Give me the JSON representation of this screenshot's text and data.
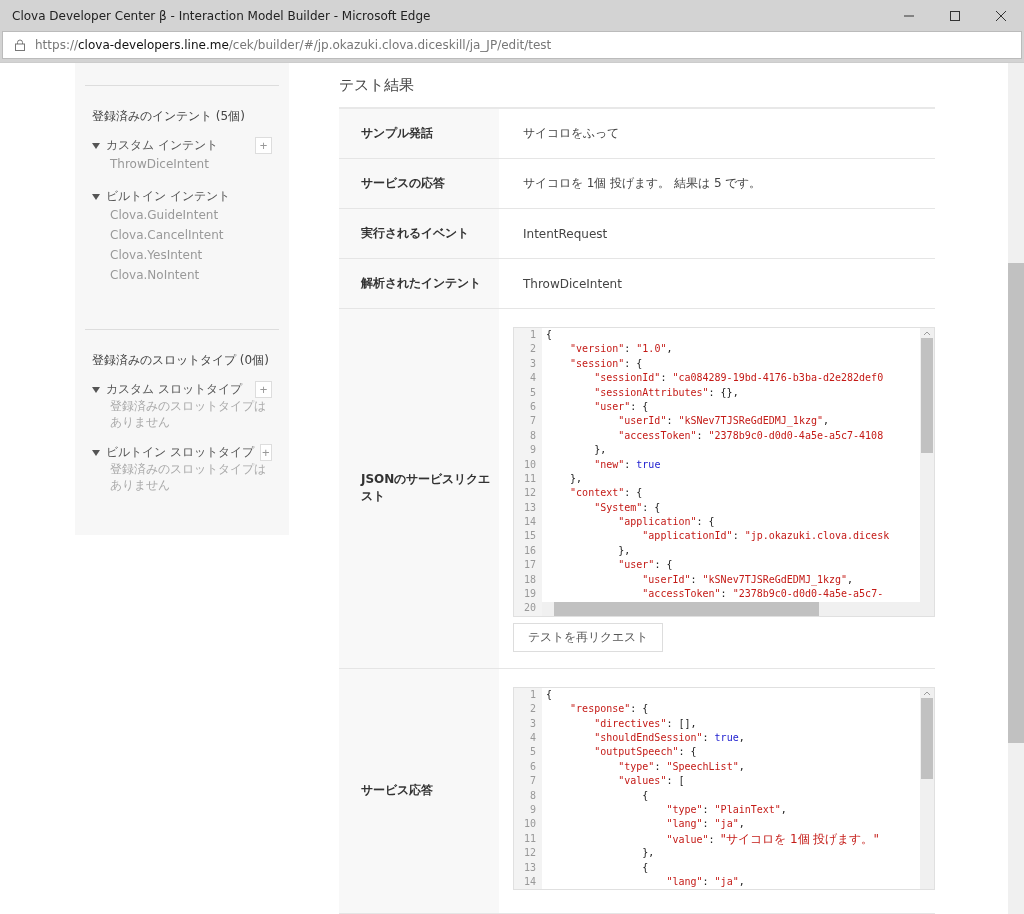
{
  "window": {
    "title": "Clova Developer Center β - Interaction Model Builder - Microsoft Edge"
  },
  "address_bar": {
    "scheme": "https://",
    "host": "clova-developers.line.me",
    "path": "/cek/builder/#/jp.okazuki.clova.diceskill/ja_JP/edit/test"
  },
  "sidebar": {
    "sections": [
      {
        "heading": "登録済みのインテント (5個)",
        "groups": [
          {
            "label": "カスタム インテント",
            "expanded": true,
            "add": "+",
            "items": [
              "ThrowDiceIntent"
            ]
          },
          {
            "label": "ビルトイン インテント",
            "expanded": true,
            "items": [
              "Clova.GuideIntent",
              "Clova.CancelIntent",
              "Clova.YesIntent",
              "Clova.NoIntent"
            ]
          }
        ]
      },
      {
        "heading": "登録済みのスロットタイプ (0個)",
        "groups": [
          {
            "label": "カスタム スロットタイプ",
            "expanded": true,
            "add": "+",
            "empty": "登録済みのスロットタイプはありません"
          },
          {
            "label": "ビルトイン スロットタイプ",
            "expanded": true,
            "add": "+",
            "empty": "登録済みのスロットタイプはありません"
          }
        ]
      }
    ]
  },
  "test_result": {
    "title": "テスト結果",
    "rows": [
      {
        "kind": "text",
        "label": "サンプル発話",
        "value": "サイコロをふって"
      },
      {
        "kind": "text",
        "label": "サービスの応答",
        "value": "サイコロを 1個 投げます。 結果は 5 です。"
      },
      {
        "kind": "text",
        "label": "実行されるイベント",
        "value": "IntentRequest"
      },
      {
        "kind": "text",
        "label": "解析されたインテント",
        "value": "ThrowDiceIntent"
      },
      {
        "kind": "code",
        "label": "JSONのサービスリクエスト",
        "button": "テストを再リクエスト",
        "lines": [
          {
            "number": "1",
            "tokens": [
              {
                "kind": "punct",
                "text": "{"
              }
            ]
          },
          {
            "number": "2",
            "tokens": [
              {
                "kind": "string",
                "text": "    \"version\""
              },
              {
                "kind": "punct",
                "text": ": "
              },
              {
                "kind": "string",
                "text": "\"1.0\""
              },
              {
                "kind": "punct",
                "text": ","
              }
            ]
          },
          {
            "number": "3",
            "tokens": [
              {
                "kind": "string",
                "text": "    \"session\""
              },
              {
                "kind": "punct",
                "text": ": {"
              }
            ]
          },
          {
            "number": "4",
            "tokens": [
              {
                "kind": "string",
                "text": "        \"sessionId\""
              },
              {
                "kind": "punct",
                "text": ": "
              },
              {
                "kind": "string",
                "text": "\"ca084289-19bd-4176-b3ba-d2e282def0"
              }
            ]
          },
          {
            "number": "5",
            "tokens": [
              {
                "kind": "string",
                "text": "        \"sessionAttributes\""
              },
              {
                "kind": "punct",
                "text": ": {},"
              }
            ]
          },
          {
            "number": "6",
            "tokens": [
              {
                "kind": "string",
                "text": "        \"user\""
              },
              {
                "kind": "punct",
                "text": ": {"
              }
            ]
          },
          {
            "number": "7",
            "tokens": [
              {
                "kind": "string",
                "text": "            \"userId\""
              },
              {
                "kind": "punct",
                "text": ": "
              },
              {
                "kind": "string",
                "text": "\"kSNev7TJSReGdEDMJ_1kzg\""
              },
              {
                "kind": "punct",
                "text": ","
              }
            ]
          },
          {
            "number": "8",
            "tokens": [
              {
                "kind": "string",
                "text": "            \"accessToken\""
              },
              {
                "kind": "punct",
                "text": ": "
              },
              {
                "kind": "string",
                "text": "\"2378b9c0-d0d0-4a5e-a5c7-4108"
              }
            ]
          },
          {
            "number": "9",
            "tokens": [
              {
                "kind": "punct",
                "text": "        },"
              }
            ]
          },
          {
            "number": "10",
            "tokens": [
              {
                "kind": "string",
                "text": "        \"new\""
              },
              {
                "kind": "punct",
                "text": ": "
              },
              {
                "kind": "keyword",
                "text": "true"
              }
            ]
          },
          {
            "number": "11",
            "tokens": [
              {
                "kind": "punct",
                "text": "    },"
              }
            ]
          },
          {
            "number": "12",
            "tokens": [
              {
                "kind": "string",
                "text": "    \"context\""
              },
              {
                "kind": "punct",
                "text": ": {"
              }
            ]
          },
          {
            "number": "13",
            "tokens": [
              {
                "kind": "string",
                "text": "        \"System\""
              },
              {
                "kind": "punct",
                "text": ": {"
              }
            ]
          },
          {
            "number": "14",
            "tokens": [
              {
                "kind": "string",
                "text": "            \"application\""
              },
              {
                "kind": "punct",
                "text": ": {"
              }
            ]
          },
          {
            "number": "15",
            "tokens": [
              {
                "kind": "string",
                "text": "                \"applicationId\""
              },
              {
                "kind": "punct",
                "text": ": "
              },
              {
                "kind": "string",
                "text": "\"jp.okazuki.clova.dicesk"
              }
            ]
          },
          {
            "number": "16",
            "tokens": [
              {
                "kind": "punct",
                "text": "            },"
              }
            ]
          },
          {
            "number": "17",
            "tokens": [
              {
                "kind": "string",
                "text": "            \"user\""
              },
              {
                "kind": "punct",
                "text": ": {"
              }
            ]
          },
          {
            "number": "18",
            "tokens": [
              {
                "kind": "string",
                "text": "                \"userId\""
              },
              {
                "kind": "punct",
                "text": ": "
              },
              {
                "kind": "string",
                "text": "\"kSNev7TJSReGdEDMJ_1kzg\""
              },
              {
                "kind": "punct",
                "text": ","
              }
            ]
          },
          {
            "number": "19",
            "tokens": [
              {
                "kind": "string",
                "text": "                \"accessToken\""
              },
              {
                "kind": "punct",
                "text": ": "
              },
              {
                "kind": "string",
                "text": "\"2378b9c0-d0d0-4a5e-a5c7-"
              }
            ]
          },
          {
            "number": "20"
          }
        ]
      },
      {
        "kind": "code",
        "label": "サービス応答",
        "lines": [
          {
            "number": "1",
            "tokens": [
              {
                "kind": "punct",
                "text": "{"
              }
            ]
          },
          {
            "number": "2",
            "tokens": [
              {
                "kind": "string",
                "text": "    \"response\""
              },
              {
                "kind": "punct",
                "text": ": {"
              }
            ]
          },
          {
            "number": "3",
            "tokens": [
              {
                "kind": "string",
                "text": "        \"directives\""
              },
              {
                "kind": "punct",
                "text": ": [],"
              }
            ]
          },
          {
            "number": "4",
            "tokens": [
              {
                "kind": "string",
                "text": "        \"shouldEndSession\""
              },
              {
                "kind": "punct",
                "text": ": "
              },
              {
                "kind": "keyword",
                "text": "true"
              },
              {
                "kind": "punct",
                "text": ","
              }
            ]
          },
          {
            "number": "5",
            "tokens": [
              {
                "kind": "string",
                "text": "        \"outputSpeech\""
              },
              {
                "kind": "punct",
                "text": ": {"
              }
            ]
          },
          {
            "number": "6",
            "tokens": [
              {
                "kind": "string",
                "text": "            \"type\""
              },
              {
                "kind": "punct",
                "text": ": "
              },
              {
                "kind": "string",
                "text": "\"SpeechList\""
              },
              {
                "kind": "punct",
                "text": ","
              }
            ]
          },
          {
            "number": "7",
            "tokens": [
              {
                "kind": "string",
                "text": "            \"values\""
              },
              {
                "kind": "punct",
                "text": ": ["
              }
            ]
          },
          {
            "number": "8",
            "tokens": [
              {
                "kind": "punct",
                "text": "                {"
              }
            ]
          },
          {
            "number": "9",
            "tokens": [
              {
                "kind": "string",
                "text": "                    \"type\""
              },
              {
                "kind": "punct",
                "text": ": "
              },
              {
                "kind": "string",
                "text": "\"PlainText\""
              },
              {
                "kind": "punct",
                "text": ","
              }
            ]
          },
          {
            "number": "10",
            "tokens": [
              {
                "kind": "string",
                "text": "                    \"lang\""
              },
              {
                "kind": "punct",
                "text": ": "
              },
              {
                "kind": "string",
                "text": "\"ja\""
              },
              {
                "kind": "punct",
                "text": ","
              }
            ]
          },
          {
            "number": "11",
            "tokens": [
              {
                "kind": "string",
                "text": "                    \"value\""
              },
              {
                "kind": "punct",
                "text": ": "
              },
              {
                "kind": "string",
                "text": "\"サイコロを 1個 投げます。\""
              }
            ]
          },
          {
            "number": "12",
            "tokens": [
              {
                "kind": "punct",
                "text": "                },"
              }
            ]
          },
          {
            "number": "13",
            "tokens": [
              {
                "kind": "punct",
                "text": "                {"
              }
            ]
          },
          {
            "number": "14",
            "tokens": [
              {
                "kind": "string",
                "text": "                    \"lang\""
              },
              {
                "kind": "punct",
                "text": ": "
              },
              {
                "kind": "string",
                "text": "\"ja\""
              },
              {
                "kind": "punct",
                "text": ","
              }
            ]
          }
        ]
      }
    ]
  }
}
